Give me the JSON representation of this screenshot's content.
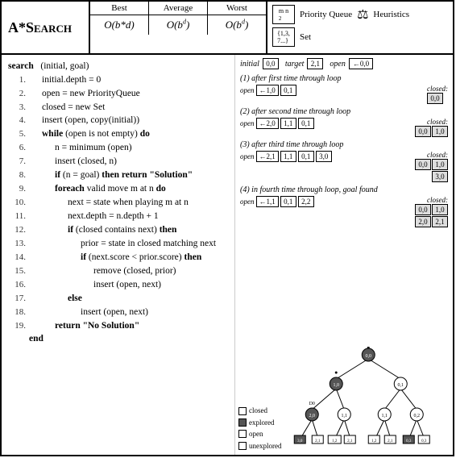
{
  "header": {
    "title": "A*Search",
    "columns": [
      "Best",
      "Average",
      "Worst"
    ],
    "complexities": [
      "O(b*d)",
      "O(bᵈ)",
      "O(bᵈ)"
    ],
    "icons": [
      {
        "icon_label": "Priority Queue",
        "icon_symbol": "mn",
        "set_label": "Set",
        "set_symbol": "1,3,7..."
      }
    ]
  },
  "pseudocode": {
    "func_sig": "search  (initial, goal)",
    "lines": [
      {
        "num": "1.",
        "text": "initial.depth = 0",
        "indent": 1
      },
      {
        "num": "2.",
        "text": "open = new PriorityQueue",
        "indent": 1
      },
      {
        "num": "3.",
        "text": "closed = new Set",
        "indent": 1
      },
      {
        "num": "4.",
        "text": "insert (open, copy(initial))",
        "indent": 1
      },
      {
        "num": "5.",
        "text": "while (open is not empty) do",
        "indent": 1,
        "bold_parts": [
          "while",
          "do"
        ]
      },
      {
        "num": "6.",
        "text": "n = minimum (open)",
        "indent": 2
      },
      {
        "num": "7.",
        "text": "insert (closed, n)",
        "indent": 2
      },
      {
        "num": "8.",
        "text": "if (n = goal) then return \"Solution\"",
        "indent": 2,
        "bold_parts": [
          "if",
          "then return"
        ]
      },
      {
        "num": "9.",
        "text": "foreach valid move m at n do",
        "indent": 2,
        "bold_parts": [
          "foreach",
          "do"
        ]
      },
      {
        "num": "10.",
        "text": "next = state when playing m at n",
        "indent": 3
      },
      {
        "num": "11.",
        "text": "next.depth = n.depth + 1",
        "indent": 3
      },
      {
        "num": "12.",
        "text": "if (closed contains next) then",
        "indent": 3,
        "bold_parts": [
          "if",
          "then"
        ]
      },
      {
        "num": "13.",
        "text": "prior = state in closed matching next",
        "indent": 4
      },
      {
        "num": "14.",
        "text": "if (next.score < prior.score) then",
        "indent": 4,
        "bold_parts": [
          "if",
          "then"
        ]
      },
      {
        "num": "15.",
        "text": "remove (closed, prior)",
        "indent": 5
      },
      {
        "num": "16.",
        "text": "insert (open, next)",
        "indent": 5
      },
      {
        "num": "17.",
        "text": "else",
        "indent": 3,
        "bold_parts": [
          "else"
        ]
      },
      {
        "num": "18.",
        "text": "insert (open, next)",
        "indent": 4
      },
      {
        "num": "19.",
        "text": "return \"No Solution\"",
        "indent": 2,
        "bold_parts": [
          "return"
        ]
      },
      {
        "num": "",
        "text": "end",
        "indent": 0,
        "bold": true
      }
    ]
  },
  "visualization": {
    "initial_label": "initial",
    "initial_val": "0,0",
    "target_label": "target",
    "target_val": "2,1",
    "open_label": "open",
    "open_val": "←0,0",
    "sections": [
      {
        "label": "(1) after first time through loop",
        "open_vals": [
          "←1,0",
          "0,1"
        ],
        "closed_label": "closed:",
        "closed_vals": [
          "0,0"
        ]
      },
      {
        "label": "(2) after second time through loop",
        "open_vals": [
          "←2,0",
          "1,1",
          "0,1"
        ],
        "closed_label": "closed:",
        "closed_vals": [
          "0,0",
          "1,0"
        ]
      },
      {
        "label": "(3) after third time through loop",
        "open_vals": [
          "←2,1",
          "1,1",
          "0,1",
          "3,0"
        ],
        "closed_label": "closed:",
        "closed_vals": [
          "0,0",
          "1,0",
          "3,0"
        ]
      },
      {
        "label": "(4) in fourth time through loop, goal found",
        "open_vals": [
          "←1,1",
          "0,1",
          "2,2"
        ],
        "closed_label": "closed:",
        "closed_vals": [
          "0,0",
          "1,0",
          "2,0",
          "2,1"
        ]
      }
    ],
    "legend": [
      {
        "type": "closed",
        "label": "closed"
      },
      {
        "type": "explored",
        "label": "explored"
      },
      {
        "type": "open",
        "label": "open"
      },
      {
        "type": "unexplored",
        "label": "unexplored"
      }
    ]
  }
}
